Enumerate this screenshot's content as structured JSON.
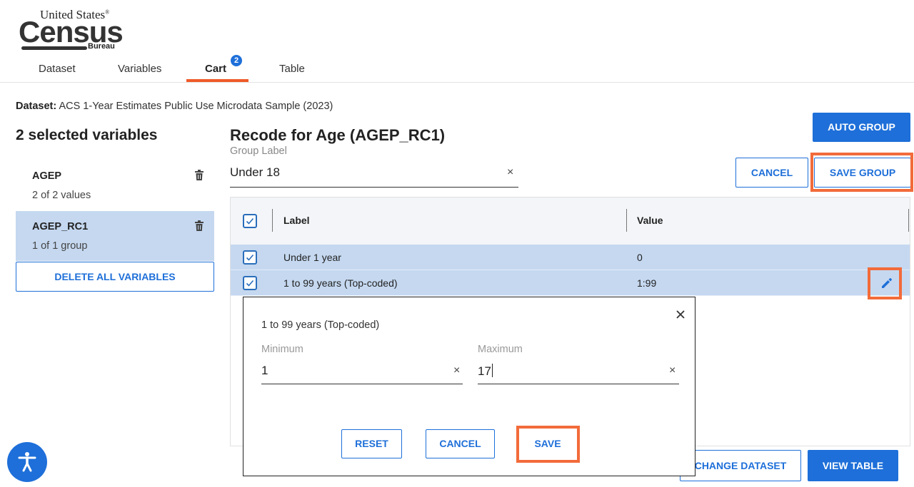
{
  "logo": {
    "line1": "United States",
    "line2": "Census",
    "line3": "Bureau"
  },
  "tabs": [
    {
      "label": "Dataset"
    },
    {
      "label": "Variables"
    },
    {
      "label": "Cart",
      "badge": "2"
    },
    {
      "label": "Table"
    }
  ],
  "dataset": {
    "prefix": "Dataset:",
    "name": "ACS 1-Year Estimates Public Use Microdata Sample (2023)"
  },
  "left": {
    "title": "2 selected variables",
    "variables": [
      {
        "name": "AGEP",
        "sub": "2 of 2 values"
      },
      {
        "name": "AGEP_RC1",
        "sub": "1 of 1 group"
      }
    ],
    "delete_all": "DELETE ALL VARIABLES"
  },
  "main": {
    "title": "Recode for Age (AGEP_RC1)",
    "group_label": "Group Label",
    "group_value": "Under 18",
    "auto_group": "AUTO GROUP",
    "cancel": "CANCEL",
    "save_group": "SAVE GROUP",
    "table": {
      "headers": [
        "Label",
        "Value"
      ],
      "rows": [
        {
          "label": "Under 1 year",
          "value": "0"
        },
        {
          "label": "1 to 99 years (Top-coded)",
          "value": "1:99"
        }
      ]
    },
    "change_dataset": "CHANGE DATASET",
    "view_table": "VIEW TABLE"
  },
  "dialog": {
    "title": "1 to 99 years (Top-coded)",
    "min_label": "Minimum",
    "min_value": "1",
    "max_label": "Maximum",
    "max_value": "17",
    "reset": "RESET",
    "cancel": "CANCEL",
    "save": "SAVE"
  },
  "icons": {
    "trash": "trash-icon",
    "close": "close-icon",
    "check": "checkmark-icon",
    "pencil": "pencil-icon",
    "accessibility": "accessibility-icon"
  },
  "colors": {
    "primary": "#1e6fd9",
    "highlight": "#f26b3a",
    "selected_row": "#c5d8f0",
    "tab_underline": "#f05a28"
  }
}
